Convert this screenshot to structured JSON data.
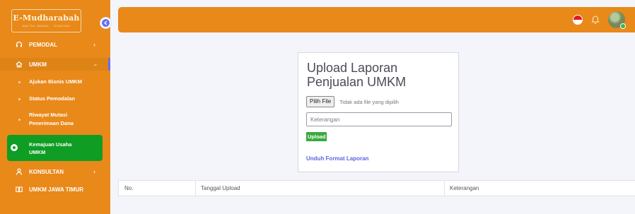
{
  "brand": {
    "name": "E-Mudharabah",
    "tagline": "BAITUL MASAL · SYARIAH"
  },
  "sidebar": {
    "items": [
      {
        "label": "PEMODAL",
        "icon": "headset-icon"
      },
      {
        "label": "UMKM",
        "icon": "home-icon"
      },
      {
        "label": "KONSULTAN",
        "icon": "user-icon"
      },
      {
        "label": "UMKM JAWA TIMUR",
        "icon": "book-icon"
      }
    ],
    "umkm_sub": [
      {
        "label": "Ajukan Bisnis UMKM"
      },
      {
        "label": "Status Pemodalan"
      },
      {
        "label_line1": "Riwayat Mutasi",
        "label_line2": "Penerimaan Dana"
      },
      {
        "label_line1": "Kemajuan Usaha",
        "label_line2": "UMKM",
        "active": true
      }
    ]
  },
  "topbar": {
    "flag": "indonesia-flag",
    "notification_icon": "bell-icon"
  },
  "upload_card": {
    "title_line1": "Upload Laporan",
    "title_line2": "Penjualan UMKM",
    "file_button": "Pilih File",
    "file_status": "Tidak ada file yang dipilih",
    "keterangan_placeholder": "Keterangan",
    "keterangan_value": "",
    "upload_button": "Upload",
    "download_link": "Unduh Format Laporan"
  },
  "table": {
    "columns": [
      "No.",
      "Tanggal Upload",
      "Keterangan"
    ],
    "rows": []
  },
  "colors": {
    "primary": "#e8891a",
    "accent": "#6a6ff0",
    "active_green": "#0f9d24",
    "upload_green": "#3aaa3c"
  }
}
